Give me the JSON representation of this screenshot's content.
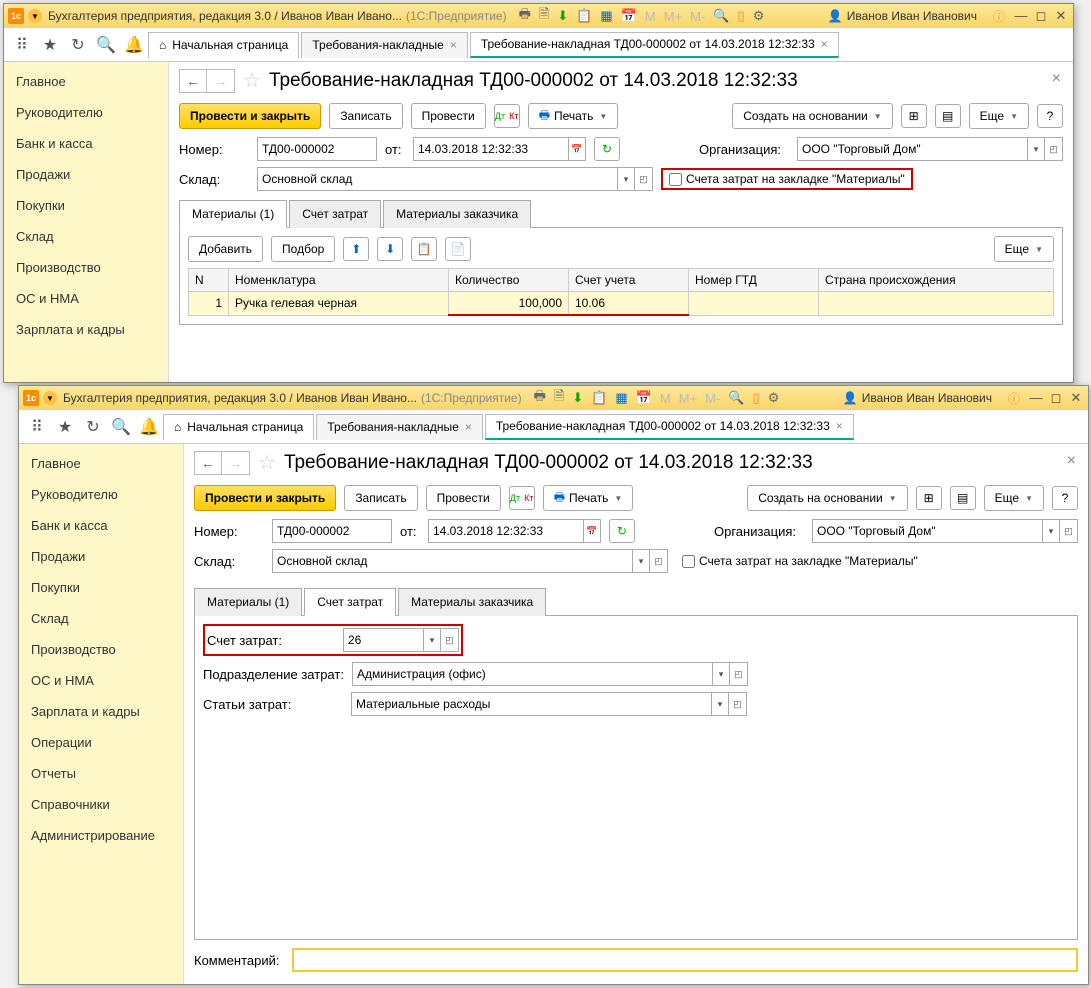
{
  "titlebar": {
    "app_title": "Бухгалтерия предприятия, редакция 3.0 / Иванов Иван Ивано...",
    "platform": "(1C:Предприятие)",
    "user": "Иванов Иван Иванович"
  },
  "tabs": {
    "home": "Начальная страница",
    "list": "Требования-накладные",
    "doc": "Требование-накладная ТД00-000002 от 14.03.2018 12:32:33"
  },
  "sidebar": {
    "items": [
      "Главное",
      "Руководителю",
      "Банк и касса",
      "Продажи",
      "Покупки",
      "Склад",
      "Производство",
      "ОС и НМА",
      "Зарплата и кадры",
      "Операции",
      "Отчеты",
      "Справочники",
      "Администрирование"
    ]
  },
  "page": {
    "title": "Требование-накладная ТД00-000002 от 14.03.2018 12:32:33",
    "btn_post_close": "Провести и закрыть",
    "btn_save": "Записать",
    "btn_post": "Провести",
    "btn_print": "Печать",
    "btn_create_based": "Создать на основании",
    "btn_more": "Еще",
    "lbl_number": "Номер:",
    "number": "ТД00-000002",
    "lbl_from": "от:",
    "date": "14.03.2018 12:32:33",
    "lbl_org": "Организация:",
    "org": "ООО \"Торговый Дом\"",
    "lbl_warehouse": "Склад:",
    "warehouse": "Основной склад",
    "chk_cost_accounts": "Счета затрат на закладке \"Материалы\""
  },
  "doc_tabs": {
    "materials": "Материалы (1)",
    "cost": "Счет затрат",
    "customer_mat": "Материалы заказчика"
  },
  "materials_panel": {
    "btn_add": "Добавить",
    "btn_select": "Подбор",
    "btn_more": "Еще",
    "cols": {
      "n": "N",
      "nom": "Номенклатура",
      "qty": "Количество",
      "acc": "Счет учета",
      "gtd": "Номер ГТД",
      "country": "Страна происхождения"
    },
    "row1": {
      "n": "1",
      "nom": "Ручка гелевая черная",
      "qty": "100,000",
      "acc": "10.06",
      "gtd": "",
      "country": ""
    }
  },
  "cost_panel": {
    "lbl_acc": "Счет затрат:",
    "acc": "26",
    "lbl_dept": "Подразделение затрат:",
    "dept": "Администрация (офис)",
    "lbl_item": "Статьи затрат:",
    "item": "Материальные расходы",
    "lbl_comment": "Комментарий:",
    "comment": ""
  }
}
